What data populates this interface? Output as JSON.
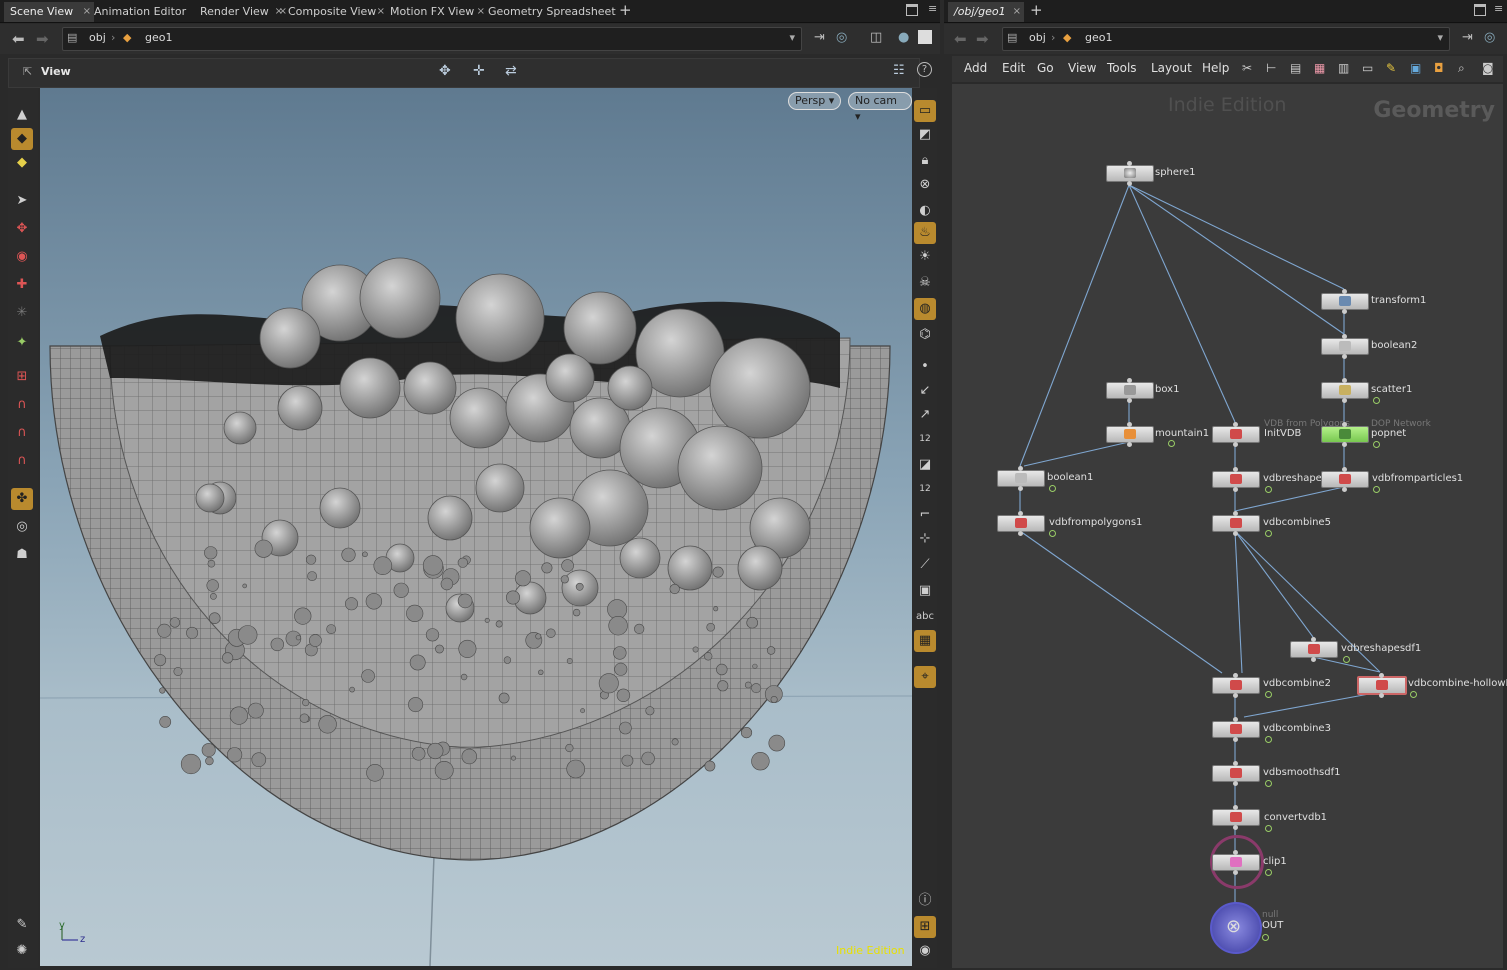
{
  "left_pane": {
    "tabs": [
      "Scene View",
      "Animation Editor",
      "Render View",
      "Composite View",
      "Motion FX View",
      "Geometry Spreadsheet"
    ],
    "path": [
      "obj",
      "geo1"
    ],
    "view_label": "View",
    "viewport": {
      "persp_label": "Persp",
      "cam_label": "No cam",
      "watermark": "Indie Edition",
      "axis_y": "y",
      "axis_z": "z",
      "right_tool_labels": [
        "12",
        "12",
        "abc"
      ]
    }
  },
  "right_pane": {
    "tab": "/obj/geo1",
    "path": [
      "obj",
      "geo1"
    ],
    "menu": [
      "Add",
      "Edit",
      "Go",
      "View",
      "Tools",
      "Layout",
      "Help"
    ],
    "watermark": "Indie Edition",
    "context_label": "Geometry",
    "nodes": [
      {
        "name": "sphere1"
      },
      {
        "name": "transform1"
      },
      {
        "name": "boolean2"
      },
      {
        "name": "scatter1"
      },
      {
        "name": "box1"
      },
      {
        "name": "mountain1"
      },
      {
        "name": "InitVDB",
        "subtitle": "VDB from Polygons"
      },
      {
        "name": "popnet",
        "subtitle": "DOP Network"
      },
      {
        "name": "boolean1"
      },
      {
        "name": "vdbreshapesd"
      },
      {
        "name": "vdbfromparticles1"
      },
      {
        "name": "vdbfrompolygons1"
      },
      {
        "name": "vdbcombine5"
      },
      {
        "name": "vdbreshapesdf1"
      },
      {
        "name": "vdbcombine2"
      },
      {
        "name": "vdbcombine-hollowBu"
      },
      {
        "name": "vdbcombine3"
      },
      {
        "name": "vdbsmoothsdf1"
      },
      {
        "name": "convertvdb1"
      },
      {
        "name": "clip1"
      },
      {
        "name": "OUT",
        "subtitle": "null"
      }
    ]
  },
  "colors": {
    "tab_bg": "#1e1e1e",
    "viewport_top": "#5f7a90",
    "viewport_bottom": "#b9c9d2",
    "network_bg": "#3b3b3b",
    "wire": "#7fa6d0",
    "highlight": "#b98a2e"
  }
}
